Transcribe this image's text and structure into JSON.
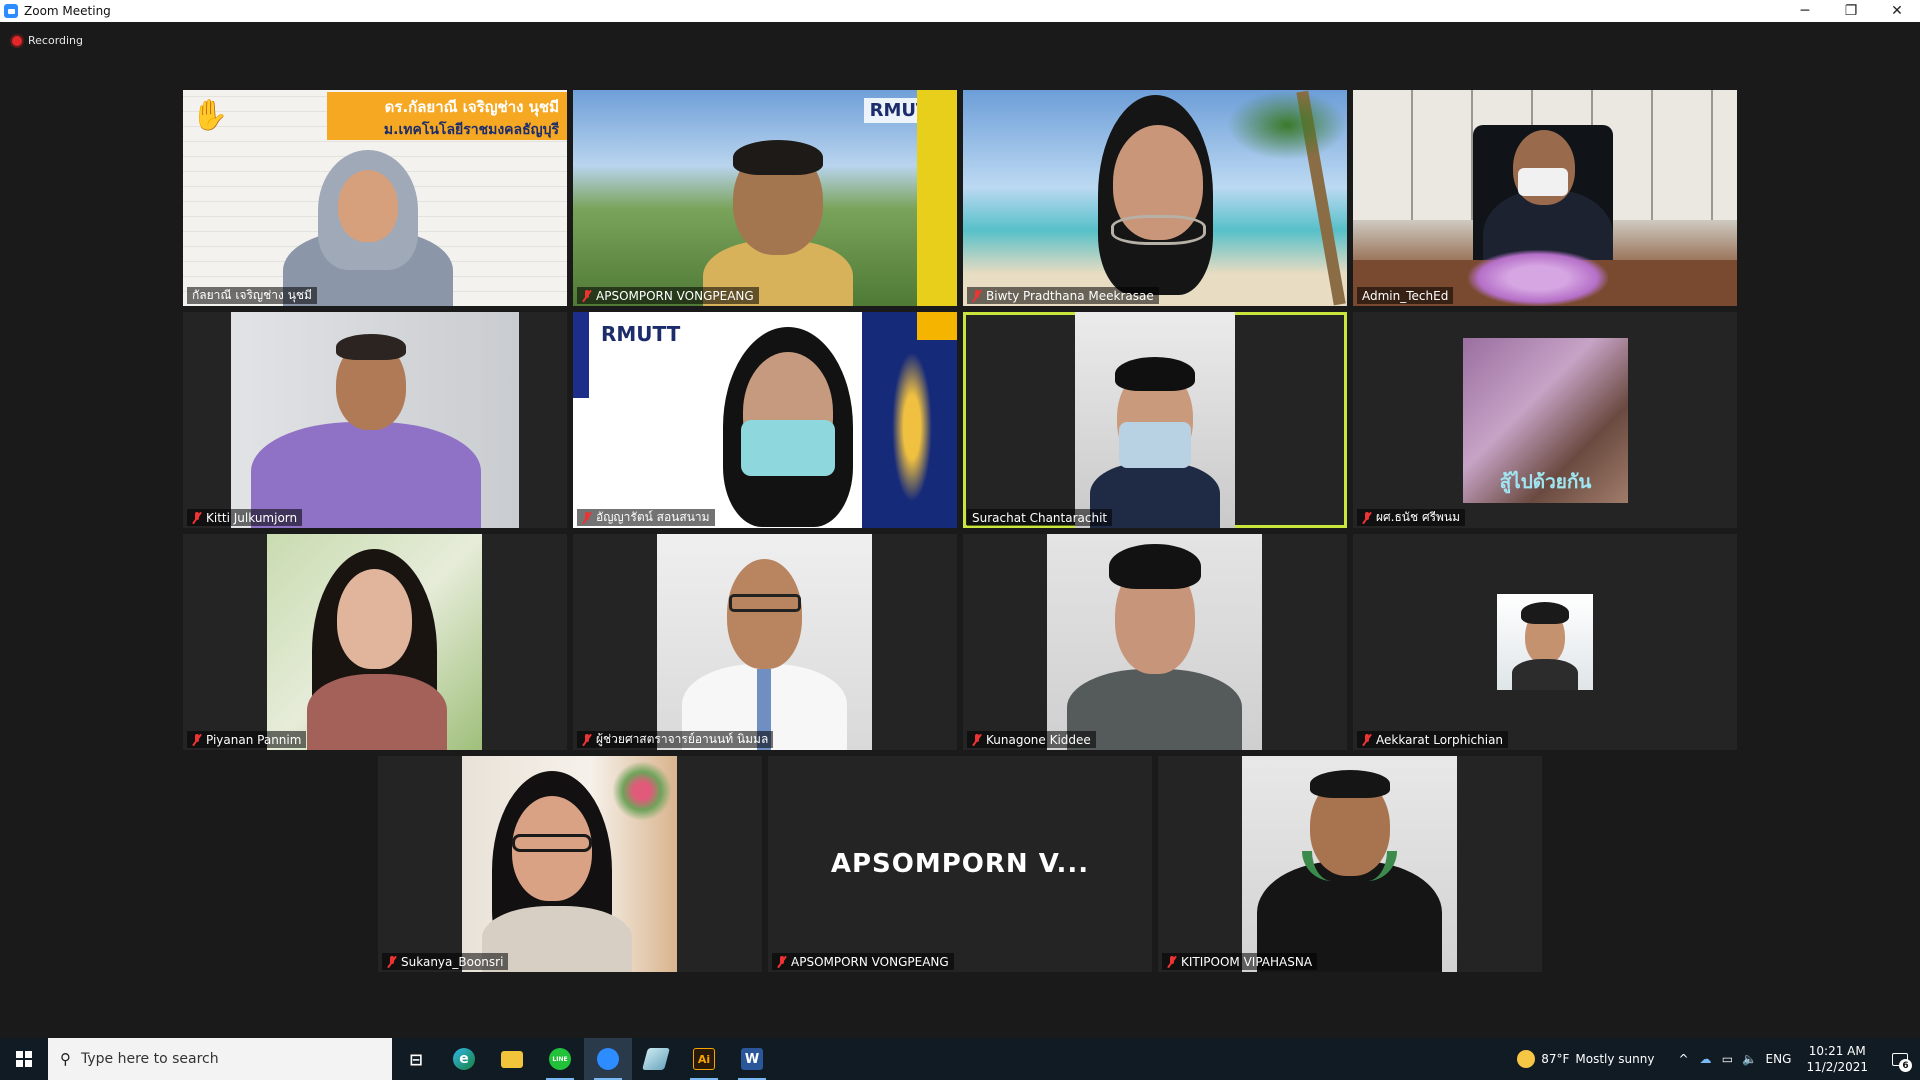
{
  "window": {
    "title": "Zoom Meeting",
    "minimize_glyph": "─",
    "maximize_glyph": "❐",
    "close_glyph": "✕"
  },
  "recording": {
    "label": "Recording",
    "color": "#e02828"
  },
  "participants": [
    {
      "name": "กัลยาณี เจริญช่าง นุชมี",
      "muted": false,
      "banner_line1": "ดร.กัลยาณี เจริญช่าง นุชมี",
      "banner_line2": "ม.เทคโนโลยีราชมงคลธัญบุรี",
      "hand_raised": true
    },
    {
      "name": "APSOMPORN VONGPEANG",
      "muted": true,
      "logo": "RMUTT"
    },
    {
      "name": "Biwty Pradthana Meekrasae",
      "muted": true
    },
    {
      "name": "Admin_TechEd",
      "muted": false
    },
    {
      "name": "Kitti Julkumjorn",
      "muted": true
    },
    {
      "name": "อัญญารัตน์ สอนสนาม",
      "muted": true,
      "logo": "RMUTT"
    },
    {
      "name": "Surachat Chantarachit",
      "muted": false,
      "active_speaker": true
    },
    {
      "name": "ผศ.ธนัช ศรีพนม",
      "muted": true,
      "overlay_text": "สู้ไปด้วยกัน"
    },
    {
      "name": "Piyanan Pannim",
      "muted": true
    },
    {
      "name": "ผู้ช่วยศาสตราจารย์อานนท์ นิมมล",
      "muted": true
    },
    {
      "name": "Kunagone Kiddee",
      "muted": true
    },
    {
      "name": "Aekkarat Lorphichian",
      "muted": true
    },
    {
      "name": "Sukanya_Boonsri",
      "muted": true
    },
    {
      "name": "APSOMPORN VONGPEANG",
      "muted": true,
      "video_off_label": "APSOMPORN  V..."
    },
    {
      "name": "KITIPOOM VIPAHASNA",
      "muted": true
    }
  ],
  "taskbar": {
    "search_placeholder": "Type here to search",
    "apps": [
      {
        "name": "task-view",
        "icon": "task-view-icon",
        "label": "⊟"
      },
      {
        "name": "edge",
        "icon": "edge-icon",
        "label": "e"
      },
      {
        "name": "file-explorer",
        "icon": "folder-icon",
        "label": ""
      },
      {
        "name": "line",
        "icon": "line-icon",
        "label": "LINE"
      },
      {
        "name": "zoom",
        "icon": "zoom-icon",
        "label": ""
      },
      {
        "name": "feather",
        "icon": "feather-icon",
        "label": ""
      },
      {
        "name": "illustrator",
        "icon": "illustrator-icon",
        "label": "Ai"
      },
      {
        "name": "word",
        "icon": "word-icon",
        "label": "W"
      }
    ],
    "weather": {
      "temp": "87°F",
      "condition": "Mostly sunny"
    },
    "tray": {
      "chevron": "^",
      "language": "ENG",
      "notifications": "6"
    },
    "clock": {
      "time": "10:21 AM",
      "date": "11/2/2021"
    }
  }
}
